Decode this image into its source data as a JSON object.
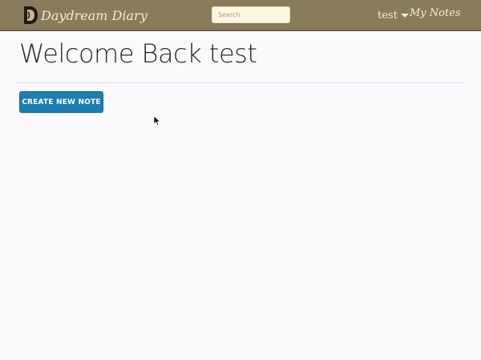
{
  "app": {
    "brand_name": "Daydream Diary",
    "brand_logo_icon": "letter-d-logo-icon"
  },
  "navbar": {
    "background_color": "#8a7b5b",
    "search_placeholder": "Search",
    "search_value": "",
    "user_name": "test",
    "user_dropdown_icon": "caret-down-icon",
    "my_notes_label": "My Notes"
  },
  "main": {
    "welcome_text": "Welcome Back test",
    "create_note_label": "CREATE NEW NOTE",
    "accent_color": "#1d7eb1"
  },
  "cursor": {
    "icon": "arrow-cursor-icon"
  }
}
